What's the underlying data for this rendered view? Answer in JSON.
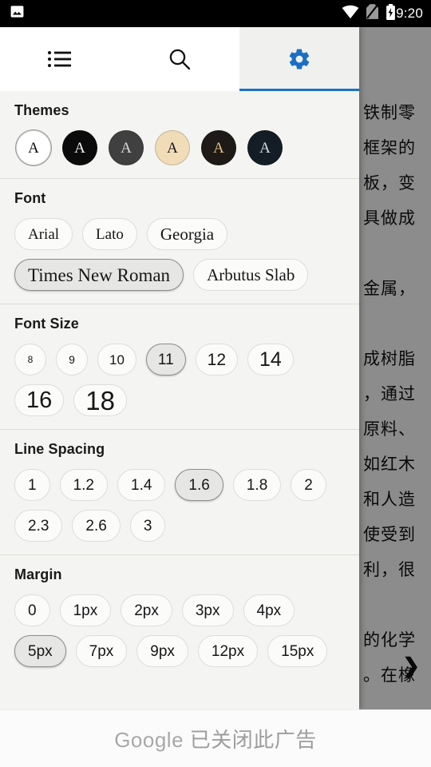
{
  "statusbar": {
    "time": "9:20",
    "icons": [
      "image-notification-icon",
      "wifi-icon",
      "no-sim-icon",
      "battery-charging-icon"
    ]
  },
  "reader": {
    "body_text": "铁制零\n框架的\n板，变\n具做成\n\n金属，\n\n成树脂\n，通过\n原料、\n如红木\n和人造\n使受到\n利，很\n\n的化学\n。在橡",
    "next_page_icon": "chevron-right-icon"
  },
  "panel": {
    "tabs": [
      {
        "name": "contents",
        "icon": "list-icon",
        "active": false
      },
      {
        "name": "search",
        "icon": "search-icon",
        "active": false
      },
      {
        "name": "settings",
        "icon": "gear-icon",
        "active": true
      }
    ],
    "accent_color": "#1a73c8",
    "sections": [
      {
        "id": "themes",
        "title": "Themes",
        "type": "themes",
        "options": [
          {
            "label": "A",
            "bg": "#ffffff",
            "fg": "#111111",
            "selected": true
          },
          {
            "label": "A",
            "bg": "#0b0b0b",
            "fg": "#f2f2f2",
            "selected": false
          },
          {
            "label": "A",
            "bg": "#404040",
            "fg": "#d8d8d8",
            "selected": false
          },
          {
            "label": "A",
            "bg": "#f0ddb8",
            "fg": "#161616",
            "selected": false
          },
          {
            "label": "A",
            "bg": "#1d1a17",
            "fg": "#e2bd84",
            "selected": false
          },
          {
            "label": "A",
            "bg": "#141d26",
            "fg": "#d5dde4",
            "selected": false
          }
        ]
      },
      {
        "id": "font",
        "title": "Font",
        "type": "chips",
        "options": [
          {
            "label": "Arial",
            "selected": false,
            "size": 19
          },
          {
            "label": "Lato",
            "selected": false,
            "size": 19
          },
          {
            "label": "Georgia",
            "selected": false,
            "size": 21
          },
          {
            "label": "Times New Roman",
            "selected": true,
            "size": 23
          },
          {
            "label": "Arbutus Slab",
            "selected": false,
            "size": 21
          }
        ]
      },
      {
        "id": "font-size",
        "title": "Font Size",
        "type": "chips",
        "options": [
          {
            "label": "8",
            "selected": false,
            "size": 12
          },
          {
            "label": "9",
            "selected": false,
            "size": 14
          },
          {
            "label": "10",
            "selected": false,
            "size": 17
          },
          {
            "label": "11",
            "selected": true,
            "size": 19
          },
          {
            "label": "12",
            "selected": false,
            "size": 21
          },
          {
            "label": "14",
            "selected": false,
            "size": 25
          },
          {
            "label": "16",
            "selected": false,
            "size": 29
          },
          {
            "label": "18",
            "selected": false,
            "size": 33
          }
        ]
      },
      {
        "id": "line-spacing",
        "title": "Line Spacing",
        "type": "chips",
        "options": [
          {
            "label": "1",
            "selected": false,
            "size": 19
          },
          {
            "label": "1.2",
            "selected": false,
            "size": 19
          },
          {
            "label": "1.4",
            "selected": false,
            "size": 19
          },
          {
            "label": "1.6",
            "selected": true,
            "size": 19
          },
          {
            "label": "1.8",
            "selected": false,
            "size": 19
          },
          {
            "label": "2",
            "selected": false,
            "size": 19
          },
          {
            "label": "2.3",
            "selected": false,
            "size": 19
          },
          {
            "label": "2.6",
            "selected": false,
            "size": 19
          },
          {
            "label": "3",
            "selected": false,
            "size": 19
          }
        ]
      },
      {
        "id": "margin",
        "title": "Margin",
        "type": "chips",
        "options": [
          {
            "label": "0",
            "selected": false,
            "size": 19
          },
          {
            "label": "1px",
            "selected": false,
            "size": 19
          },
          {
            "label": "2px",
            "selected": false,
            "size": 19
          },
          {
            "label": "3px",
            "selected": false,
            "size": 19
          },
          {
            "label": "4px",
            "selected": false,
            "size": 19
          },
          {
            "label": "5px",
            "selected": true,
            "size": 19
          },
          {
            "label": "7px",
            "selected": false,
            "size": 19
          },
          {
            "label": "9px",
            "selected": false,
            "size": 19
          },
          {
            "label": "12px",
            "selected": false,
            "size": 19
          },
          {
            "label": "15px",
            "selected": false,
            "size": 19
          }
        ]
      }
    ]
  },
  "ad": {
    "brand": "Google",
    "message": "已关闭此广告"
  }
}
